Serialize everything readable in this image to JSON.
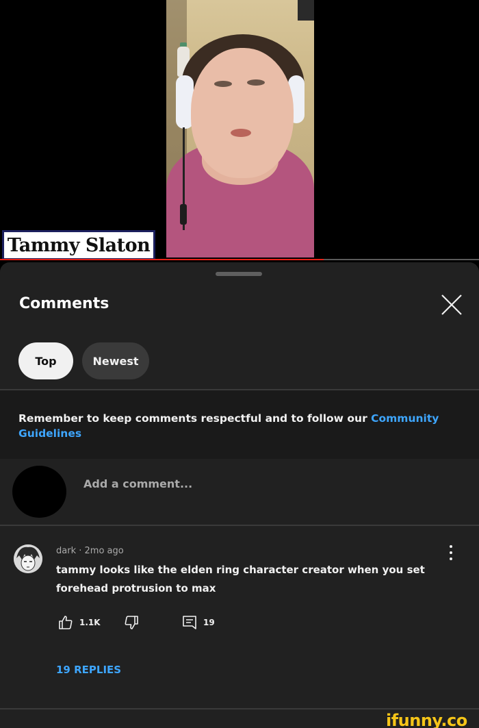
{
  "video": {
    "name_tag": "Tammy Slaton",
    "progress_fraction": 0.675
  },
  "comments_panel": {
    "title": "Comments",
    "sort_chips": [
      {
        "label": "Top",
        "selected": true
      },
      {
        "label": "Newest",
        "selected": false
      }
    ],
    "notice": {
      "text": "Remember to keep comments respectful and to follow our ",
      "link": "Community Guidelines"
    },
    "add_comment": {
      "placeholder": "Add a comment..."
    },
    "comment": {
      "author": "dark",
      "separator": "·",
      "time": "2mo ago",
      "text": "tammy looks like the elden ring character creator when you set forehead protrusion to max",
      "likes": "1.1K",
      "reply_count": "19",
      "replies_label": "19 REPLIES"
    }
  },
  "watermark": "ifunny.co",
  "colors": {
    "sheet_bg": "#212121",
    "notice_bg": "#1a1a1a",
    "link": "#3ea6ff",
    "progress": "#e62117",
    "watermark": "#f5c518"
  }
}
